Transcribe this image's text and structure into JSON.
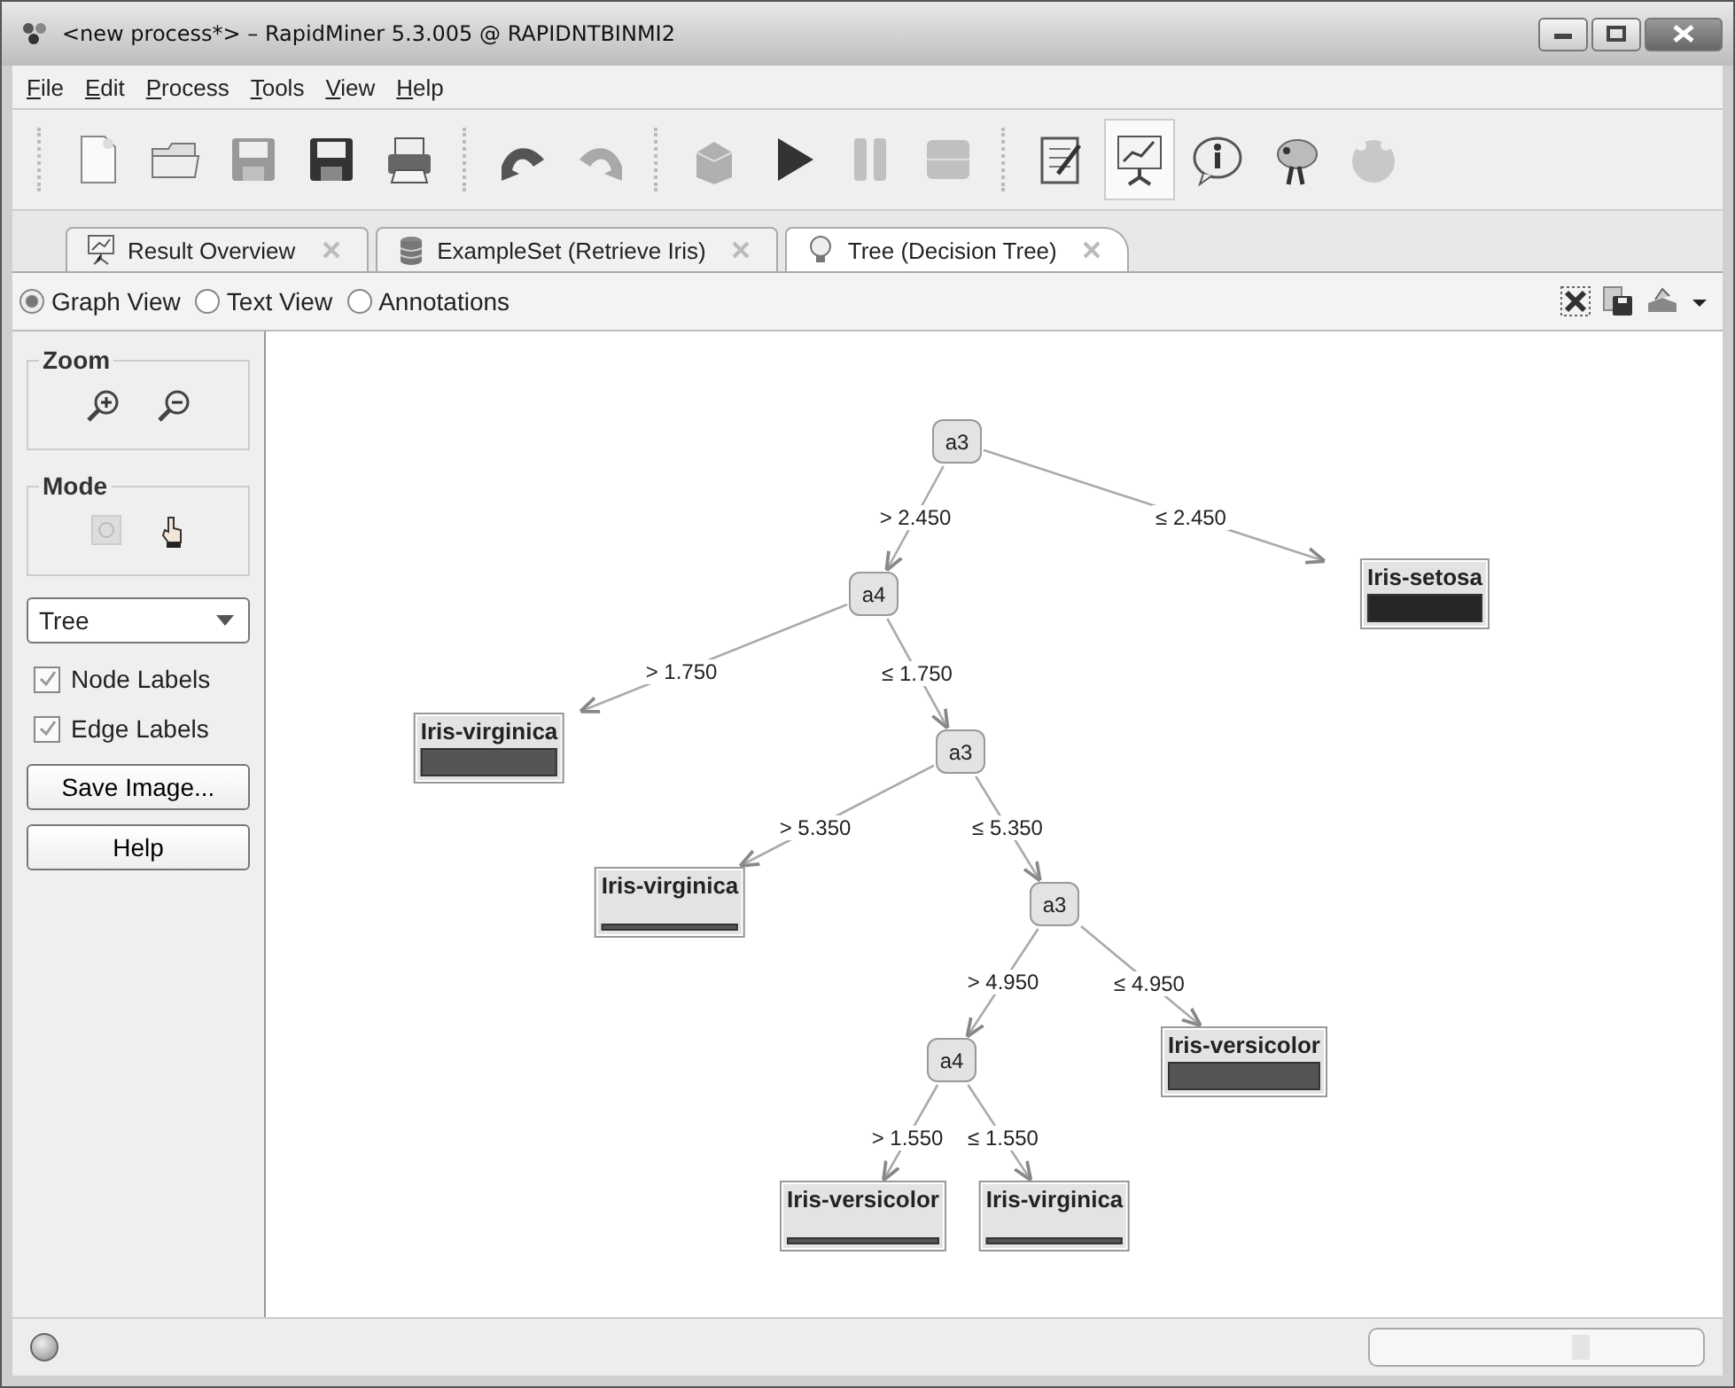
{
  "window": {
    "title": "<new process*> – RapidMiner 5.3.005 @ RAPIDNTBINMI2"
  },
  "menu": [
    "File",
    "Edit",
    "Process",
    "Tools",
    "View",
    "Help"
  ],
  "toolbar_groups": [
    {
      "buttons": [
        {
          "kind": "new",
          "disabled": false,
          "selected": false
        },
        {
          "kind": "open",
          "disabled": false,
          "selected": false
        },
        {
          "kind": "save",
          "disabled": true,
          "selected": false
        },
        {
          "kind": "saveas",
          "disabled": false,
          "selected": false
        },
        {
          "kind": "print",
          "disabled": false,
          "selected": false
        }
      ]
    },
    {
      "buttons": [
        {
          "kind": "undo",
          "disabled": false,
          "selected": false
        },
        {
          "kind": "redo",
          "disabled": true,
          "selected": false
        }
      ]
    },
    {
      "buttons": [
        {
          "kind": "cube",
          "disabled": true,
          "selected": false
        },
        {
          "kind": "play",
          "disabled": false,
          "selected": false
        },
        {
          "kind": "pause",
          "disabled": true,
          "selected": false
        },
        {
          "kind": "stop",
          "disabled": true,
          "selected": false
        }
      ]
    },
    {
      "buttons": [
        {
          "kind": "notepad",
          "disabled": false,
          "selected": false
        },
        {
          "kind": "chart",
          "disabled": false,
          "selected": true
        },
        {
          "kind": "info",
          "disabled": false,
          "selected": false
        },
        {
          "kind": "creature",
          "disabled": false,
          "selected": false
        },
        {
          "kind": "circle",
          "disabled": true,
          "selected": false
        }
      ]
    }
  ],
  "tabs": [
    {
      "label": "Result Overview",
      "kind": "chart",
      "selected": false
    },
    {
      "label": "ExampleSet (Retrieve Iris)",
      "kind": "database",
      "selected": false
    },
    {
      "label": "Tree (Decision Tree)",
      "kind": "bulb",
      "selected": true
    }
  ],
  "views": [
    {
      "label": "Graph View",
      "selected": true
    },
    {
      "label": "Text View",
      "selected": false
    },
    {
      "label": "Annotations",
      "selected": false
    }
  ],
  "side_panel": {
    "zoom_title": "Zoom",
    "mode_title": "Mode",
    "layout_select": "Tree",
    "checkboxes": [
      {
        "label": "Node Labels",
        "checked": true
      },
      {
        "label": "Edge Labels",
        "checked": true
      }
    ],
    "buttons": [
      "Save Image...",
      "Help"
    ]
  },
  "progress": {
    "level": 0
  },
  "tree": {
    "kind": "split",
    "label": "a3",
    "children": [
      {
        "edge": "> 2.450",
        "node": {
          "kind": "split",
          "label": "a4",
          "children": [
            {
              "edge": "> 1.750",
              "node": {
                "kind": "leaf",
                "label": "Iris-virginica",
                "thin": false,
                "color": "#555555"
              }
            },
            {
              "edge": "≤ 1.750",
              "node": {
                "kind": "split",
                "label": "a3",
                "children": [
                  {
                    "edge": "> 5.350",
                    "node": {
                      "kind": "leaf",
                      "label": "Iris-virginica",
                      "thin": true,
                      "color": "#555555"
                    }
                  },
                  {
                    "edge": "≤ 5.350",
                    "node": {
                      "kind": "split",
                      "label": "a3",
                      "children": [
                        {
                          "edge": "> 4.950",
                          "node": {
                            "kind": "split",
                            "label": "a4",
                            "children": [
                              {
                                "edge": "> 1.550",
                                "node": {
                                  "kind": "leaf",
                                  "label": "Iris-versicolor",
                                  "thin": true,
                                  "color": "#555555"
                                }
                              },
                              {
                                "edge": "≤ 1.550",
                                "node": {
                                  "kind": "leaf",
                                  "label": "Iris-virginica",
                                  "thin": true,
                                  "color": "#555555"
                                }
                              }
                            ]
                          }
                        },
                        {
                          "edge": "≤ 4.950",
                          "node": {
                            "kind": "leaf",
                            "label": "Iris-versicolor",
                            "thin": false,
                            "color": "#555555"
                          }
                        }
                      ]
                    }
                  }
                ]
              }
            }
          ]
        }
      },
      {
        "edge": "≤ 2.450",
        "node": {
          "kind": "leaf",
          "label": "Iris-setosa",
          "thin": false,
          "color": "#262626"
        }
      }
    ]
  }
}
